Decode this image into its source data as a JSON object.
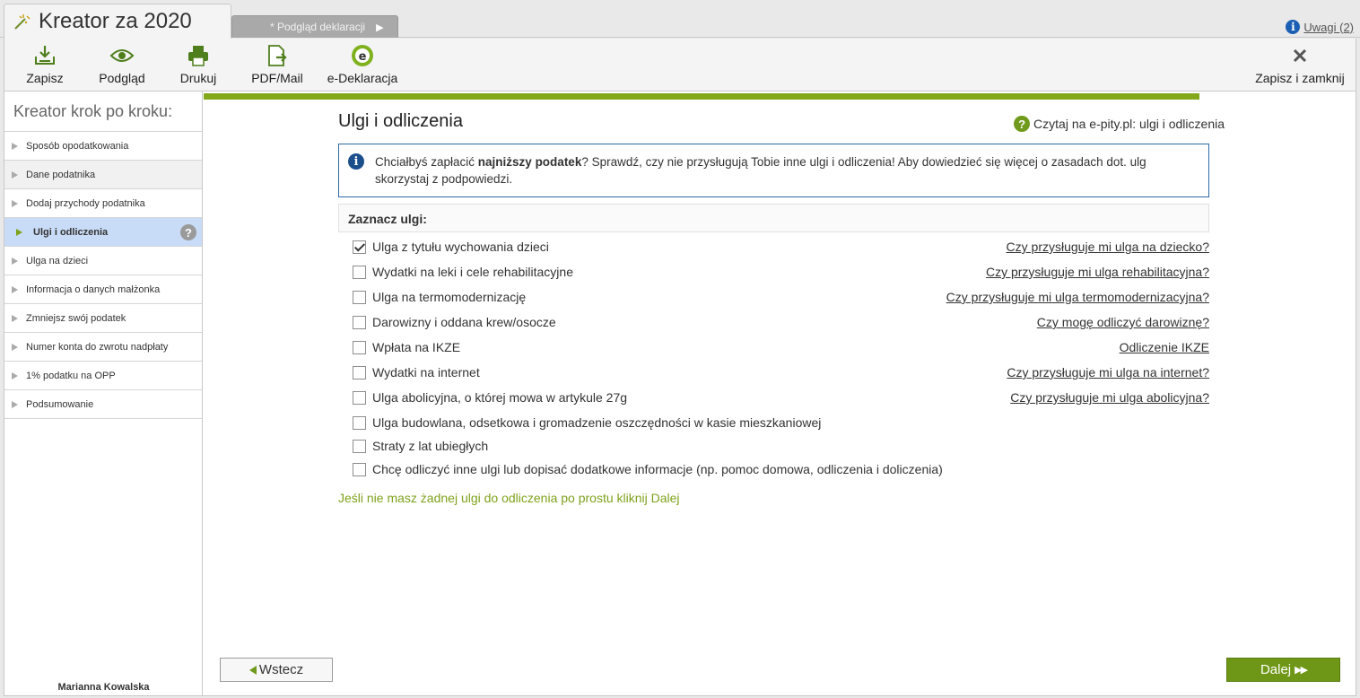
{
  "app": {
    "title": "Kreator za 2020",
    "preview_tab": "* Podgląd deklaracji",
    "uwagi_label": "Uwagi (2)"
  },
  "toolbar": {
    "save": "Zapisz",
    "preview": "Podgląd",
    "print": "Drukuj",
    "pdf": "PDF/Mail",
    "edeclaration": "e-Deklaracja",
    "save_close": "Zapisz i zamknij"
  },
  "sidebar": {
    "heading": "Kreator krok po kroku:",
    "items": [
      {
        "label": "Sposób opodatkowania"
      },
      {
        "label": "Dane podatnika"
      },
      {
        "label": "Dodaj przychody podatnika"
      },
      {
        "label": "Ulgi i odliczenia"
      },
      {
        "label": "Ulga na dzieci"
      },
      {
        "label": "Informacja o danych małżonka"
      },
      {
        "label": "Zmniejsz swój podatek"
      },
      {
        "label": "Numer konta do zwrotu nadpłaty"
      },
      {
        "label": "1% podatku na OPP"
      },
      {
        "label": "Podsumowanie"
      }
    ],
    "active_help": "?",
    "user": "Marianna Kowalska"
  },
  "main": {
    "title": "Ulgi i odliczenia",
    "read_link": "Czytaj na e-pity.pl: ulgi i odliczenia",
    "notice_pre": "Chciałbyś zapłacić ",
    "notice_bold": "najniższy podatek",
    "notice_post": "? Sprawdź, czy nie przysługują Tobie inne ulgi i odliczenia! Aby dowiedzieć się więcej o zasadach dot. ulg skorzystaj z podpowiedzi.",
    "select_heading": "Zaznacz ulgi:",
    "reliefs": [
      {
        "label": "Ulga z tytułu wychowania dzieci",
        "link": "Czy przysługuje mi ulga na dziecko?",
        "checked": true
      },
      {
        "label": "Wydatki na leki i cele rehabilitacyjne",
        "link": "Czy przysługuje mi ulga rehabilitacyjna?",
        "checked": false
      },
      {
        "label": "Ulga na termomodernizację",
        "link": "Czy przysługuje mi ulga termomodernizacyjna?",
        "checked": false
      },
      {
        "label": "Darowizny i oddana krew/osocze",
        "link": "Czy mogę odliczyć darowiznę?",
        "checked": false
      },
      {
        "label": "Wpłata na IKZE",
        "link": "Odliczenie IKZE",
        "checked": false
      },
      {
        "label": "Wydatki na internet",
        "link": "Czy przysługuje mi ulga na internet?",
        "checked": false
      },
      {
        "label": "Ulga abolicyjna, o której mowa w artykule 27g",
        "link": "Czy przysługuje mi ulga abolicyjna?",
        "checked": false
      },
      {
        "label": "Ulga budowlana, odsetkowa i gromadzenie oszczędności w kasie mieszkaniowej",
        "link": "",
        "checked": false
      },
      {
        "label": "Straty z lat ubiegłych",
        "link": "",
        "checked": false
      },
      {
        "label": "Chcę odliczyć inne ulgi lub dopisać dodatkowe informacje (np. pomoc domowa, odliczenia i doliczenia)",
        "link": "",
        "checked": false
      }
    ],
    "no_relief_hint": "Jeśli nie masz żadnej ulgi do odliczenia po prostu kliknij Dalej",
    "back_label": "Wstecz",
    "next_label": "Dalej"
  },
  "colors": {
    "accent_green": "#83a81a",
    "button_green": "#6f9717",
    "active_step": "#c9dcf7",
    "notice_border": "#2c6aa6"
  },
  "icons": {
    "wand": "wand-icon",
    "save": "save-tray-icon",
    "preview": "eye-icon",
    "print": "printer-icon",
    "pdf": "pdf-export-icon",
    "edeclaration": "e-declaration-icon",
    "close": "close-x-icon",
    "info": "info-icon",
    "help": "question-icon"
  }
}
